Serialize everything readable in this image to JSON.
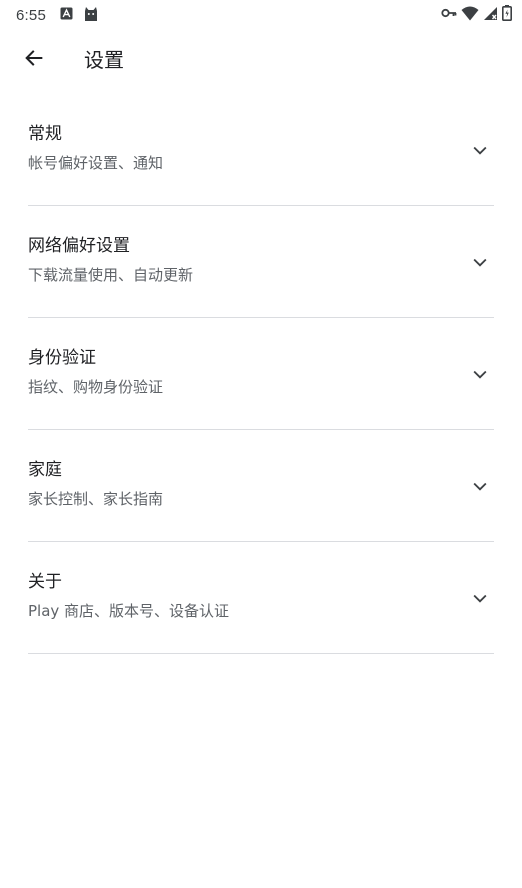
{
  "status_bar": {
    "time": "6:55",
    "left_icons": [
      "a-box-icon",
      "android-cat-icon"
    ],
    "right_icons": [
      "vpn-key-icon",
      "wifi-icon",
      "signal-icon",
      "battery-icon"
    ]
  },
  "app_bar": {
    "title": "设置",
    "back_icon": "arrow-back-icon"
  },
  "settings": {
    "items": [
      {
        "title": "常规",
        "subtitle": "帐号偏好设置、通知"
      },
      {
        "title": "网络偏好设置",
        "subtitle": "下载流量使用、自动更新"
      },
      {
        "title": "身份验证",
        "subtitle": "指纹、购物身份验证"
      },
      {
        "title": "家庭",
        "subtitle": "家长控制、家长指南"
      },
      {
        "title": "关于",
        "subtitle": "Play 商店、版本号、设备认证"
      }
    ]
  },
  "colors": {
    "primary_text": "#202124",
    "secondary_text": "#5f6368",
    "divider": "#dadce0",
    "background": "#ffffff"
  }
}
